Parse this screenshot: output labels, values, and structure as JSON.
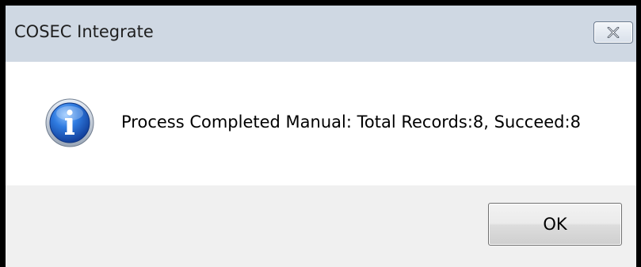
{
  "window": {
    "title": "COSEC Integrate",
    "close_icon": "close-icon"
  },
  "message": {
    "icon": "info-icon",
    "text": "Process Completed Manual: Total Records:8, Succeed:8"
  },
  "buttons": {
    "ok_label": "OK"
  },
  "colors": {
    "titlebar": "#cfd8e3",
    "content_bg": "#ffffff",
    "footer_bg": "#f0f0f0",
    "frame": "#000000",
    "info_icon_blue": "#1e5fc1"
  }
}
